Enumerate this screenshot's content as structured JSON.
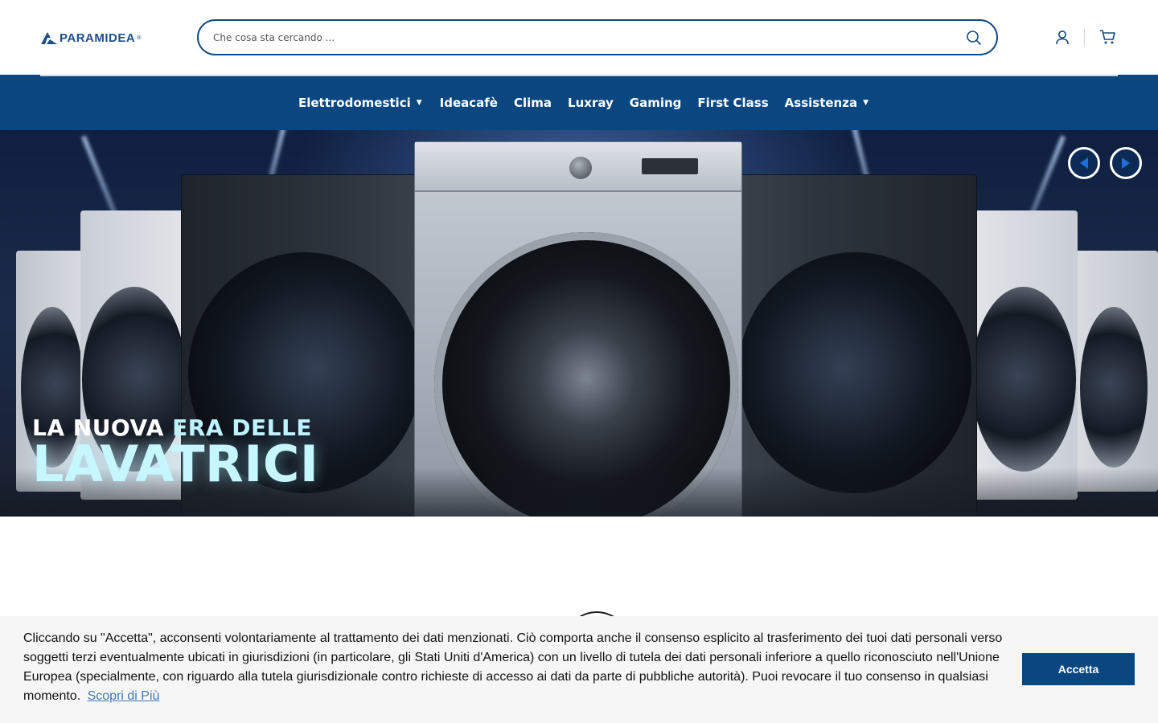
{
  "header": {
    "logo_text": "PARAMIDEA",
    "logo_reg": "®",
    "search_placeholder": "Che cosa sta cercando ..."
  },
  "nav": {
    "items": [
      {
        "label": "Elettrodomestici",
        "has_dropdown": true
      },
      {
        "label": "Ideacafè",
        "has_dropdown": false
      },
      {
        "label": "Clima",
        "has_dropdown": false
      },
      {
        "label": "Luxray",
        "has_dropdown": false
      },
      {
        "label": "Gaming",
        "has_dropdown": false
      },
      {
        "label": "First Class",
        "has_dropdown": false
      },
      {
        "label": "Assistenza",
        "has_dropdown": true
      }
    ],
    "caret_icon": "caret-down-icon"
  },
  "hero": {
    "line1_part1": "LA NUOVA",
    "line1_accent": "ERA DELLE",
    "line2": "LAVATRICI",
    "prev_icon": "chevron-left-icon",
    "next_icon": "chevron-right-icon"
  },
  "cookie": {
    "text": "Cliccando su \"Accetta\", acconsenti volontariamente al trattamento dei dati menzionati. Ciò comporta anche il consenso esplicito al trasferimento dei tuoi dati personali verso soggetti terzi eventualmente ubicati in giurisdizioni (in particolare, gli Stati Uniti d'America) con un livello di tutela dei dati personali inferiore a quello riconosciuto nell'Unione Europea (specialmente, con riguardo alla tutela giurisdizionale contro richieste di accesso ai dati da parte di pubbliche autorità). Puoi revocare il tuo consenso in qualsiasi momento.",
    "learn_more": "Scopri di Più",
    "accept": "Accetta"
  },
  "colors": {
    "brand_blue": "#0a4781",
    "accent_cyan": "#c6f6ff",
    "link": "#3e7bb6"
  }
}
